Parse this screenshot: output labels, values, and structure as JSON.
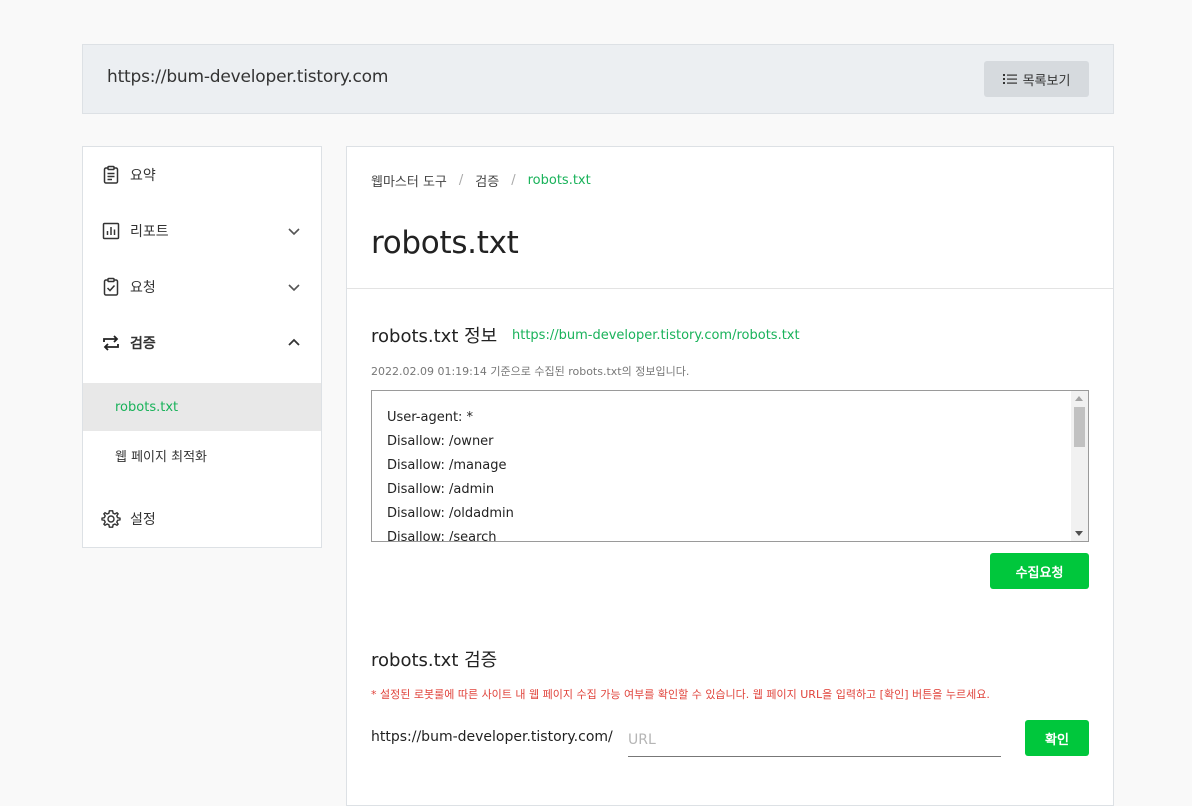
{
  "site": {
    "url": "https://bum-developer.tistory.com",
    "list_button": "목록보기"
  },
  "sidebar": {
    "items": [
      {
        "label": "요약",
        "icon": "clipboard-icon"
      },
      {
        "label": "리포트",
        "icon": "bar-chart-icon"
      },
      {
        "label": "요청",
        "icon": "clipboard-check-icon"
      },
      {
        "label": "검증",
        "icon": "swap-arrows-icon"
      }
    ],
    "sub_items": [
      {
        "label": "robots.txt",
        "active": true
      },
      {
        "label": "웹 페이지 최적화",
        "active": false
      }
    ],
    "settings": {
      "label": "설정",
      "icon": "gear-icon"
    }
  },
  "breadcrumb": [
    "웹마스터 도구",
    "검증",
    "robots.txt"
  ],
  "breadcrumb_separator": "/",
  "page_title": "robots.txt",
  "info_section": {
    "title": "robots.txt 정보",
    "link": "https://bum-developer.tistory.com/robots.txt",
    "collected_text": "2022.02.09 01:19:14 기준으로 수집된 robots.txt의 정보입니다.",
    "robots_lines": [
      "User-agent: *",
      "Disallow: /owner",
      "Disallow: /manage",
      "Disallow: /admin",
      "Disallow: /oldadmin",
      "Disallow: /search"
    ],
    "collect_button": "수집요청"
  },
  "verify_section": {
    "title": "robots.txt 검증",
    "note": "* 설정된 로봇룰에 따른 사이트 내 웹 페이지 수집 가능 여부를 확인할 수 있습니다. 웹 페이지 URL을 입력하고 [확인] 버튼을 누르세요.",
    "url_prefix": "https://bum-developer.tistory.com/",
    "input_placeholder": "URL",
    "confirm_button": "확인"
  },
  "colors": {
    "accent_green": "#00c73c",
    "link_green": "#19b25a",
    "warning_red": "#e0433b"
  }
}
